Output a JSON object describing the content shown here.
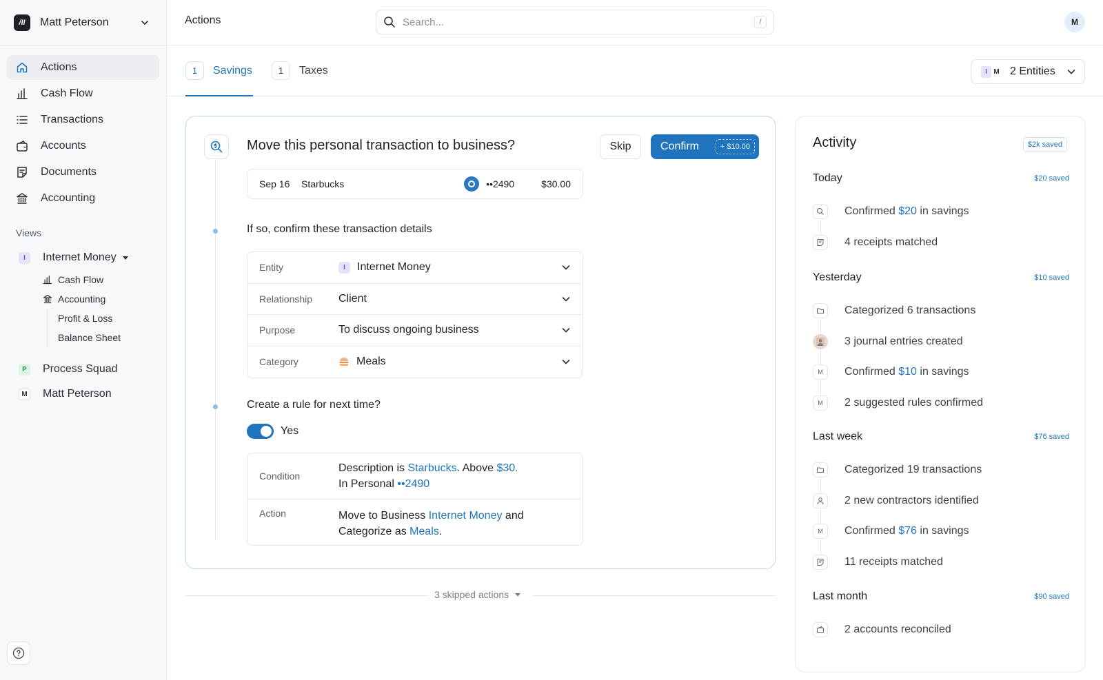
{
  "sidebar": {
    "logo_text": "/II",
    "user_name": "Matt Peterson",
    "nav": [
      {
        "label": "Actions",
        "icon": "home-icon",
        "active": true
      },
      {
        "label": "Cash Flow",
        "icon": "bar-chart-icon"
      },
      {
        "label": "Transactions",
        "icon": "list-icon"
      },
      {
        "label": "Accounts",
        "icon": "wallet-icon"
      },
      {
        "label": "Documents",
        "icon": "document-icon"
      },
      {
        "label": "Accounting",
        "icon": "bank-icon"
      }
    ],
    "views_title": "Views",
    "views": [
      {
        "badge": "I",
        "label": "Internet Money",
        "sub": [
          {
            "label": "Cash Flow",
            "icon": "bar-chart-icon"
          },
          {
            "label": "Accounting",
            "icon": "bank-icon",
            "sub": [
              "Profit & Loss",
              "Balance Sheet"
            ]
          }
        ]
      },
      {
        "badge": "P",
        "label": "Process Squad"
      },
      {
        "badge": "M",
        "label": "Matt Peterson"
      }
    ]
  },
  "topbar": {
    "title": "Actions",
    "search_placeholder": "Search...",
    "search_shortcut": "/",
    "avatar_initial": "M"
  },
  "tabs": [
    {
      "count": "1",
      "label": "Savings",
      "active": true
    },
    {
      "count": "1",
      "label": "Taxes",
      "active": false
    }
  ],
  "entities": {
    "badges": [
      "I",
      "M"
    ],
    "label": "2 Entities"
  },
  "action_card": {
    "question": "Move this personal transaction to business?",
    "skip_label": "Skip",
    "confirm_label": "Confirm",
    "confirm_amount": "+ $10.00",
    "transaction": {
      "date": "Sep 16",
      "merchant": "Starbucks",
      "account": "••2490",
      "amount": "$30.00"
    },
    "details_title": "If so, confirm these transaction details",
    "details": [
      {
        "label": "Entity",
        "value": "Internet Money",
        "badge": "I"
      },
      {
        "label": "Relationship",
        "value": "Client"
      },
      {
        "label": "Purpose",
        "value": "To discuss ongoing business"
      },
      {
        "label": "Category",
        "value": "Meals",
        "icon": "burger-icon"
      }
    ],
    "rule_title": "Create a rule for next time?",
    "rule_toggle_label": "Yes",
    "rule_toggle_on": true,
    "condition_label": "Condition",
    "condition": {
      "t1": "Description is ",
      "merchant": "Starbucks",
      "t2": ". Above ",
      "amount": "$30.",
      "t3": "In Personal ",
      "account": "••2490"
    },
    "action_label": "Action",
    "action": {
      "t1": "Move to Business ",
      "entity": "Internet Money",
      "t2": " and",
      "t3": "Categorize as ",
      "category": "Meals",
      "t4": "."
    }
  },
  "skipped_label": "3 skipped actions",
  "activity": {
    "title": "Activity",
    "total_saved": "$2k saved",
    "groups": [
      {
        "name": "Today",
        "saved": "$20 saved",
        "items": [
          {
            "icon": "search-dollar-icon",
            "pre": "Confirmed ",
            "hl": "$20",
            "post": " in savings"
          },
          {
            "icon": "receipt-icon",
            "pre": "4 receipts matched"
          }
        ]
      },
      {
        "name": "Yesterday",
        "saved": "$10 saved",
        "items": [
          {
            "icon": "folder-icon",
            "pre": "Categorized 6 transactions"
          },
          {
            "icon": "user-photo-icon",
            "pre": "3 journal entries created"
          },
          {
            "icon": "m-badge-icon",
            "badge": "M",
            "pre": "Confirmed ",
            "hl": "$10",
            "post": " in savings"
          },
          {
            "icon": "m-badge-icon",
            "badge": "M",
            "pre": "2 suggested rules confirmed"
          }
        ]
      },
      {
        "name": "Last week",
        "saved": "$76 saved",
        "items": [
          {
            "icon": "folder-icon",
            "pre": "Categorized 19 transactions"
          },
          {
            "icon": "person-icon",
            "pre": "2 new contractors identified"
          },
          {
            "icon": "m-badge-icon",
            "badge": "M",
            "pre": "Confirmed ",
            "hl": "$76",
            "post": " in savings"
          },
          {
            "icon": "receipt-icon",
            "pre": "11 receipts matched"
          }
        ]
      },
      {
        "name": "Last month",
        "saved": "$90 saved",
        "items": [
          {
            "icon": "wallet-icon",
            "pre": "2 accounts reconciled"
          }
        ]
      }
    ]
  },
  "colors": {
    "accent": "#1f74bd",
    "sidebar_bg": "#f7f8f9",
    "card_border": "#b9d6ee"
  }
}
